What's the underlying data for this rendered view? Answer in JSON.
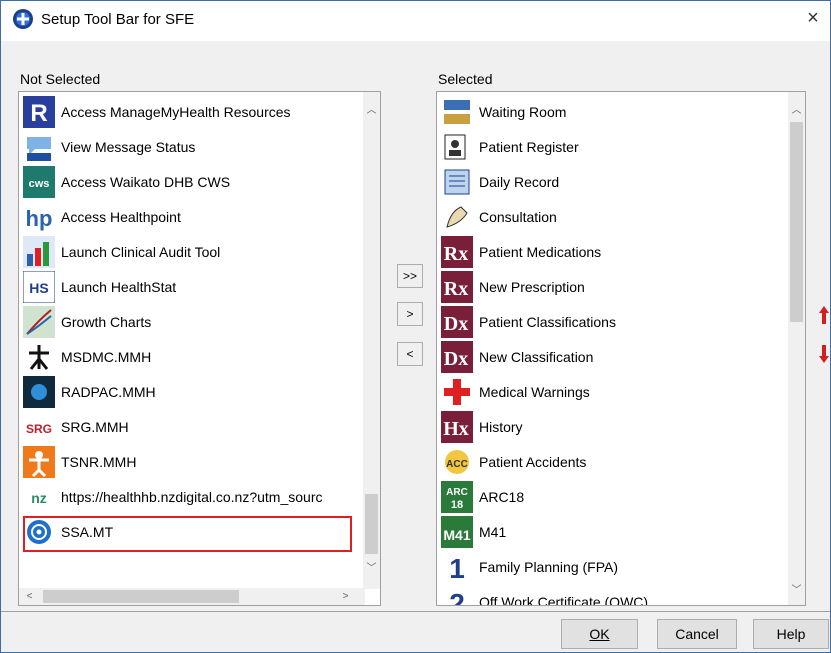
{
  "window": {
    "title": "Setup Tool Bar for SFE",
    "close_label": "×"
  },
  "not_selected": {
    "label": "Not Selected",
    "items": [
      {
        "label": "Access ManageMyHealth Resources",
        "icon": "r-logo-icon"
      },
      {
        "label": "View Message Status",
        "icon": "mmh-message-icon"
      },
      {
        "label": "Access Waikato DHB CWS",
        "icon": "cws-icon"
      },
      {
        "label": "Access Healthpoint",
        "icon": "hp-icon"
      },
      {
        "label": "Launch Clinical Audit Tool",
        "icon": "cat-icon"
      },
      {
        "label": "Launch HealthStat",
        "icon": "hs-icon"
      },
      {
        "label": "Growth Charts",
        "icon": "growth-chart-icon"
      },
      {
        "label": "MSDMC.MMH",
        "icon": "msdmc-icon"
      },
      {
        "label": "RADPAC.MMH",
        "icon": "radpac-icon"
      },
      {
        "label": "SRG.MMH",
        "icon": "srg-icon"
      },
      {
        "label": "TSNR.MMH",
        "icon": "tsnr-icon"
      },
      {
        "label": "https://healthhb.nzdigital.co.nz?utm_sourc",
        "icon": "nzdigital-icon"
      },
      {
        "label": "SSA.MT",
        "icon": "ssa-icon"
      }
    ]
  },
  "selected": {
    "label": "Selected",
    "items": [
      {
        "label": "Waiting Room",
        "icon": "waiting-room-icon"
      },
      {
        "label": "Patient Register",
        "icon": "patient-register-icon"
      },
      {
        "label": "Daily Record",
        "icon": "daily-record-icon"
      },
      {
        "label": "Consultation",
        "icon": "consultation-icon"
      },
      {
        "label": "Patient Medications",
        "icon": "rx-icon"
      },
      {
        "label": "New Prescription",
        "icon": "rx-icon"
      },
      {
        "label": "Patient Classifications",
        "icon": "dx-icon"
      },
      {
        "label": "New Classification",
        "icon": "dx-icon"
      },
      {
        "label": "Medical Warnings",
        "icon": "red-cross-icon"
      },
      {
        "label": "History",
        "icon": "hx-icon"
      },
      {
        "label": "Patient Accidents",
        "icon": "acc-icon"
      },
      {
        "label": "ARC18",
        "icon": "arc18-icon"
      },
      {
        "label": "M41",
        "icon": "m41-icon"
      },
      {
        "label": "Family Planning (FPA)",
        "icon": "fpa-icon"
      },
      {
        "label": "Off Work Certificate (OWC)",
        "icon": "owc-icon"
      }
    ]
  },
  "move_buttons": {
    "add_all": ">>",
    "add": ">",
    "remove": "<"
  },
  "buttons": {
    "ok": "OK",
    "cancel": "Cancel",
    "help": "Help"
  },
  "colors": {
    "highlight": "#e02020",
    "up_arrow": "#d02020",
    "down_arrow": "#d02020"
  }
}
